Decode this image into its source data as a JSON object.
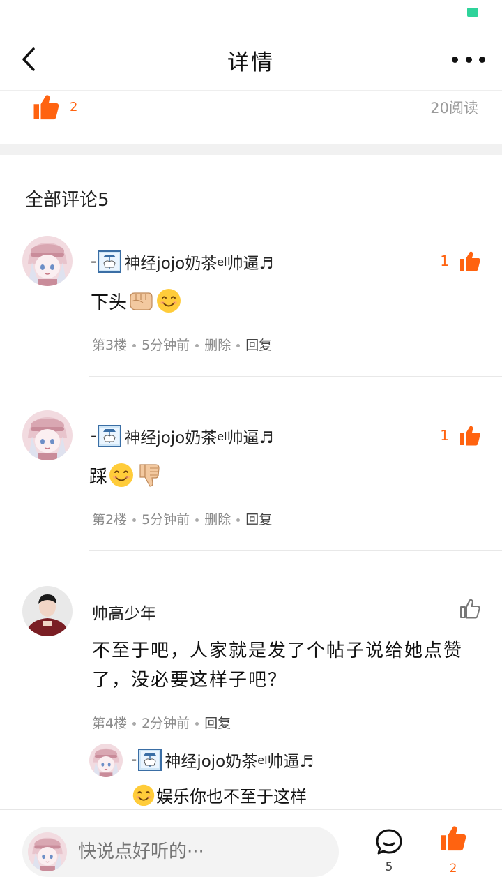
{
  "nav": {
    "title": "详情"
  },
  "post": {
    "like_count": "2",
    "reads": "20阅读"
  },
  "comments_section": {
    "title": "全部评论5"
  },
  "comments": [
    {
      "prefix": "-",
      "name_a": "神经jojo奶茶",
      "name_sup": "el",
      "name_b": "帅逼♬",
      "likes": "1",
      "text": "下头",
      "floor": "第3楼",
      "time": "5分钟前",
      "delete": "删除",
      "reply": "回复"
    },
    {
      "prefix": "-",
      "name_a": "神经jojo奶茶",
      "name_sup": "el",
      "name_b": "帅逼♬",
      "likes": "1",
      "text": "踩",
      "floor": "第2楼",
      "time": "5分钟前",
      "delete": "删除",
      "reply": "回复"
    },
    {
      "name": "帅高少年",
      "text": "不至于吧，人家就是发了个帖子说给她点赞了，没必要这样子吧？",
      "floor": "第4楼",
      "time": "2分钟前",
      "reply": "回复"
    }
  ],
  "sub_reply": {
    "prefix": "-",
    "name_a": "神经jojo奶茶",
    "name_sup": "el",
    "name_b": "帅逼♬",
    "text": "娱乐你也不至于这样"
  },
  "bottom": {
    "input_placeholder": "快说点好听的···",
    "comment_count": "5",
    "like_count": "2"
  },
  "colors": {
    "accent": "#ff6310",
    "status_green": "#2ed39a"
  }
}
